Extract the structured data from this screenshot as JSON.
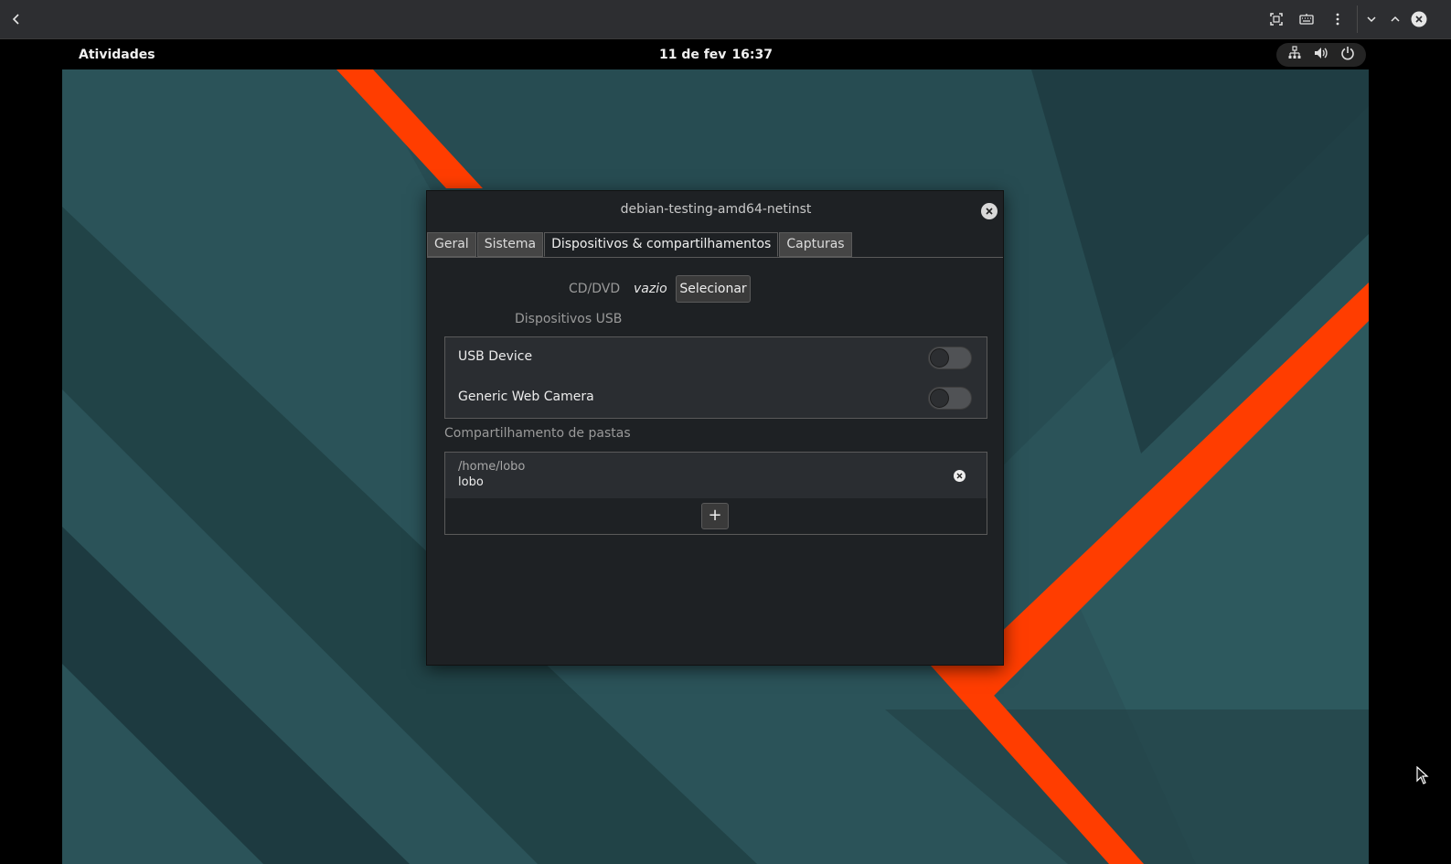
{
  "host_bar": {
    "icons": [
      "back-arrow-icon",
      "fullscreen-icon",
      "keyboard-icon",
      "kebab-menu-icon",
      "chevron-down-icon",
      "chevron-up-icon",
      "close-icon"
    ]
  },
  "gnome_bar": {
    "activities": "Atividades",
    "date": "11 de fev",
    "time": "16:37",
    "tray_icons": [
      "network-icon",
      "volume-icon",
      "power-icon"
    ]
  },
  "dialog": {
    "title": "debian-testing-amd64-netinst",
    "tabs": [
      {
        "label": "Geral",
        "active": false
      },
      {
        "label": "Sistema",
        "active": false
      },
      {
        "label": "Dispositivos & compartilhamentos",
        "active": true
      },
      {
        "label": "Capturas",
        "active": false
      }
    ],
    "cd_dvd": {
      "label": "CD/DVD",
      "value": "vazio",
      "button": "Selecionar"
    },
    "usb": {
      "label": "Dispositivos USB",
      "devices": [
        {
          "name": "USB Device",
          "enabled": false
        },
        {
          "name": "Generic Web Camera",
          "enabled": false
        }
      ]
    },
    "sharing": {
      "label": "Compartilhamento de pastas",
      "folders": [
        {
          "path": "/home/lobo",
          "name": "lobo"
        }
      ],
      "add_label": "+"
    }
  },
  "colors": {
    "wallpaper_teal": "#2b5359",
    "wallpaper_accent": "#ff3d00",
    "dialog_bg": "#1e2124"
  }
}
